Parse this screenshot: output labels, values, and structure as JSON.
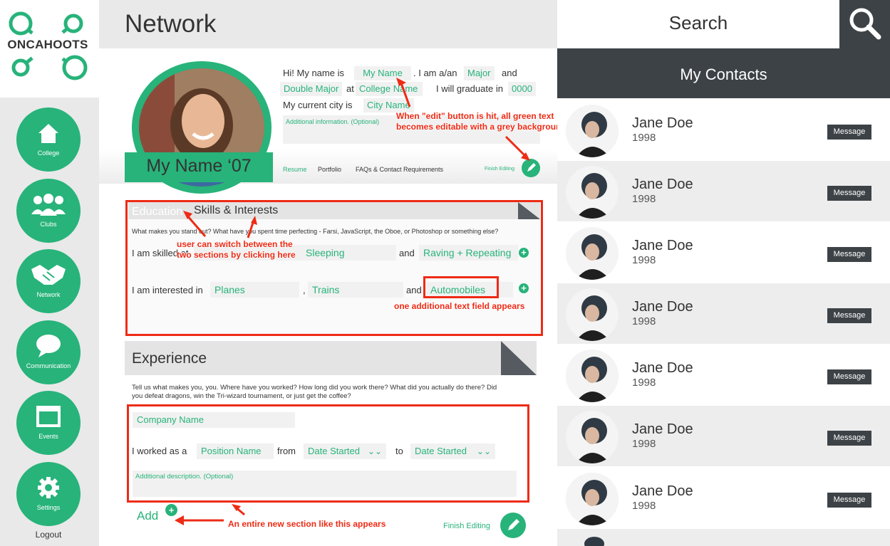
{
  "app": {
    "logo_text": "ONCAHOOTS",
    "logout": "Logout"
  },
  "colors": {
    "brand_green": "#27b37a",
    "annotation_red": "#ee2b15",
    "dark": "#3d4246"
  },
  "nav": [
    {
      "label": "College",
      "icon": "house-icon"
    },
    {
      "label": "Clubs",
      "icon": "people-icon"
    },
    {
      "label": "Network",
      "icon": "handshake-icon"
    },
    {
      "label": "Communication",
      "icon": "speech-bubble-icon"
    },
    {
      "label": "Events",
      "icon": "calendar-icon"
    },
    {
      "label": "Settings",
      "icon": "gear-icon"
    }
  ],
  "page": {
    "title": "Network"
  },
  "profile": {
    "name_banner": "My Name ‘07",
    "intro": "Hi! My name is",
    "name": "My Name",
    "iam": ". I am a/an",
    "major": "Major",
    "and": "and",
    "double_major": "Double Major",
    "at": "at",
    "college": "College Name",
    "graduate": "I will graduate in",
    "year": "0000",
    "city_label": "My current city is",
    "city": "City Name",
    "additional": "Additional information. (Optional)",
    "links": [
      "Resume",
      "Portfolio",
      "FAQs & Contact Requirements"
    ],
    "finish": "Finish Editing"
  },
  "skills": {
    "tab1": "Education",
    "tab2": "Skills & Interests",
    "prompt": "What makes you stand out?  What have you spent time perfecting - Farsi, JavaScript, the Oboe, or Photoshop or something else?",
    "skilled_label": "I am skilled at",
    "skill2": "Sleeping",
    "and": "and",
    "skill3": "Raving + Repeating",
    "interested_label": "I am interested in",
    "interest1": "Planes",
    "comma": ",",
    "interest2": "Trains",
    "and2": "and",
    "interest3": "Automobiles"
  },
  "experience": {
    "title": "Experience",
    "prompt": "Tell us what makes you, you. Where have you worked? How long did you work there? What did you actually do there? Did you defeat dragons, win the Tri-wizard tournament, or just get the coffee?",
    "company": "Company Name",
    "worked_as": "I worked as a",
    "position": "Position Name",
    "from": "from",
    "start": "Date Started",
    "to": "to",
    "end": "Date Started",
    "description": "Additional description. (Optional)",
    "add": "Add",
    "finish": "Finish Editing"
  },
  "annotations": {
    "edit_note_1": "When \"edit\" button is hit,  all green text",
    "edit_note_2": "becomes editable with a grey background",
    "switch_1": "user can switch between the",
    "switch_2": "two sections by clicking here",
    "field_appears": "one additional text field appears",
    "section_appears": "An entire new section like this appears"
  },
  "search": {
    "label": "Search"
  },
  "contacts": {
    "title": "My Contacts",
    "items": [
      {
        "name": "Jane Doe",
        "year": "1998",
        "action": "Message"
      },
      {
        "name": "Jane Doe",
        "year": "1998",
        "action": "Message"
      },
      {
        "name": "Jane Doe",
        "year": "1998",
        "action": "Message"
      },
      {
        "name": "Jane Doe",
        "year": "1998",
        "action": "Message"
      },
      {
        "name": "Jane Doe",
        "year": "1998",
        "action": "Message"
      },
      {
        "name": "Jane Doe",
        "year": "1998",
        "action": "Message"
      },
      {
        "name": "Jane Doe",
        "year": "1998",
        "action": "Message"
      }
    ]
  }
}
